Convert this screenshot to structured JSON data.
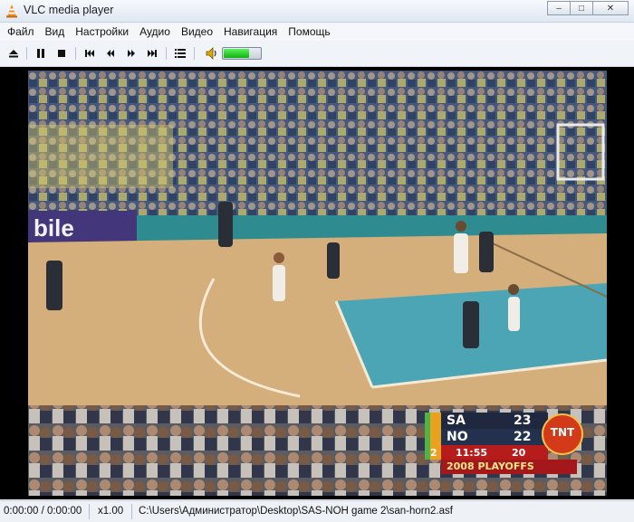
{
  "window": {
    "title": "VLC media player",
    "minimize_glyph": "–",
    "maximize_glyph": "□",
    "close_glyph": "✕"
  },
  "menubar": {
    "items": [
      "Файл",
      "Вид",
      "Настройки",
      "Аудио",
      "Видео",
      "Навигация",
      "Помощь"
    ]
  },
  "toolbar": {
    "buttons": [
      {
        "name": "eject-icon"
      },
      {
        "name": "pause-icon"
      },
      {
        "name": "stop-icon"
      },
      {
        "name": "previous-icon"
      },
      {
        "name": "rewind-icon"
      },
      {
        "name": "fast-forward-icon"
      },
      {
        "name": "next-icon"
      },
      {
        "name": "playlist-icon"
      },
      {
        "name": "speaker-icon"
      }
    ],
    "volume_level": 0.7,
    "volume_color": "#1fcf1f"
  },
  "video": {
    "scoreboard": {
      "team1": "SA",
      "score1": "23",
      "team2": "NO",
      "score2": "22",
      "quarter": "2",
      "clock": "11:55",
      "shot_clock": "20",
      "network": "TNT",
      "banner": "2008 PLAYOFFS"
    },
    "arena_sign": "bile"
  },
  "statusbar": {
    "time": "0:00:00 / 0:00:00",
    "speed": "x1.00",
    "path": "C:\\Users\\Администратор\\Desktop\\SAS-NOH game 2\\san-horn2.asf"
  }
}
